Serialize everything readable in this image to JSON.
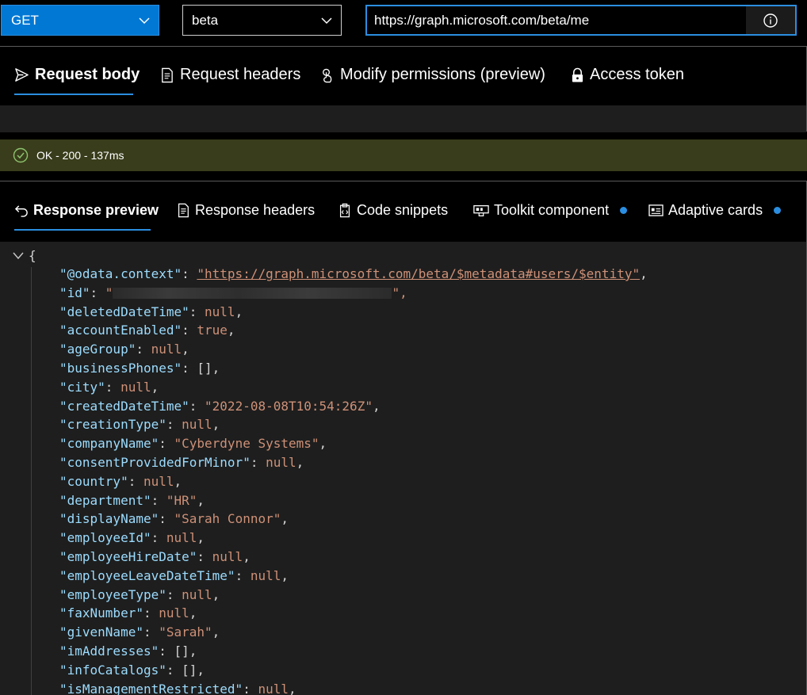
{
  "topbar": {
    "method": "GET",
    "version": "beta",
    "url": "https://graph.microsoft.com/beta/me"
  },
  "request_tabs": [
    {
      "label": "Request body",
      "icon": "send-icon"
    },
    {
      "label": "Request headers",
      "icon": "document-icon"
    },
    {
      "label": "Modify permissions (preview)",
      "icon": "touch-icon"
    },
    {
      "label": "Access token",
      "icon": "lock-icon"
    }
  ],
  "status": {
    "text": "OK - 200 - 137ms",
    "color": "#393d1b",
    "icon": "check-circle-icon"
  },
  "response_tabs": [
    {
      "label": "Response preview",
      "icon": "undo-arrow-icon"
    },
    {
      "label": "Response headers",
      "icon": "document-icon"
    },
    {
      "label": "Code snippets",
      "icon": "code-clipboard-icon"
    },
    {
      "label": "Toolkit component",
      "icon": "toolkit-icon"
    },
    {
      "label": "Adaptive cards",
      "icon": "card-icon"
    }
  ],
  "colors": {
    "accent": "#0078d4",
    "json_key": "#9cdcfe",
    "json_value": "#ce9178",
    "editor_bg": "#1e1e1e"
  },
  "json": {
    "open_brace": "{",
    "lines": [
      {
        "key": "\"@odata.context\"",
        "sep": ": ",
        "value": "\"https://graph.microsoft.com/beta/$metadata#users/$entity\"",
        "tail": ","
      },
      {
        "key": "\"id\"",
        "sep": ": ",
        "value": "\"",
        "tail": "\","
      },
      {
        "key": "\"deletedDateTime\"",
        "sep": ": ",
        "value": "null",
        "tail": ","
      },
      {
        "key": "\"accountEnabled\"",
        "sep": ": ",
        "value": "true",
        "tail": ","
      },
      {
        "key": "\"ageGroup\"",
        "sep": ": ",
        "value": "null",
        "tail": ","
      },
      {
        "key": "\"businessPhones\"",
        "sep": ": ",
        "value": "[]",
        "tail": ","
      },
      {
        "key": "\"city\"",
        "sep": ": ",
        "value": "null",
        "tail": ","
      },
      {
        "key": "\"createdDateTime\"",
        "sep": ": ",
        "value": "\"2022-08-08T10:54:26Z\"",
        "tail": ","
      },
      {
        "key": "\"creationType\"",
        "sep": ": ",
        "value": "null",
        "tail": ","
      },
      {
        "key": "\"companyName\"",
        "sep": ": ",
        "value": "\"Cyberdyne Systems\"",
        "tail": ","
      },
      {
        "key": "\"consentProvidedForMinor\"",
        "sep": ": ",
        "value": "null",
        "tail": ","
      },
      {
        "key": "\"country\"",
        "sep": ": ",
        "value": "null",
        "tail": ","
      },
      {
        "key": "\"department\"",
        "sep": ": ",
        "value": "\"HR\"",
        "tail": ","
      },
      {
        "key": "\"displayName\"",
        "sep": ": ",
        "value": "\"Sarah Connor\"",
        "tail": ","
      },
      {
        "key": "\"employeeId\"",
        "sep": ": ",
        "value": "null",
        "tail": ","
      },
      {
        "key": "\"employeeHireDate\"",
        "sep": ": ",
        "value": "null",
        "tail": ","
      },
      {
        "key": "\"employeeLeaveDateTime\"",
        "sep": ": ",
        "value": "null",
        "tail": ","
      },
      {
        "key": "\"employeeType\"",
        "sep": ": ",
        "value": "null",
        "tail": ","
      },
      {
        "key": "\"faxNumber\"",
        "sep": ": ",
        "value": "null",
        "tail": ","
      },
      {
        "key": "\"givenName\"",
        "sep": ": ",
        "value": "\"Sarah\"",
        "tail": ","
      },
      {
        "key": "\"imAddresses\"",
        "sep": ": ",
        "value": "[]",
        "tail": ","
      },
      {
        "key": "\"infoCatalogs\"",
        "sep": ": ",
        "value": "[]",
        "tail": ","
      },
      {
        "key": "\"isManagementRestricted\"",
        "sep": ": ",
        "value": "null",
        "tail": ","
      }
    ]
  }
}
